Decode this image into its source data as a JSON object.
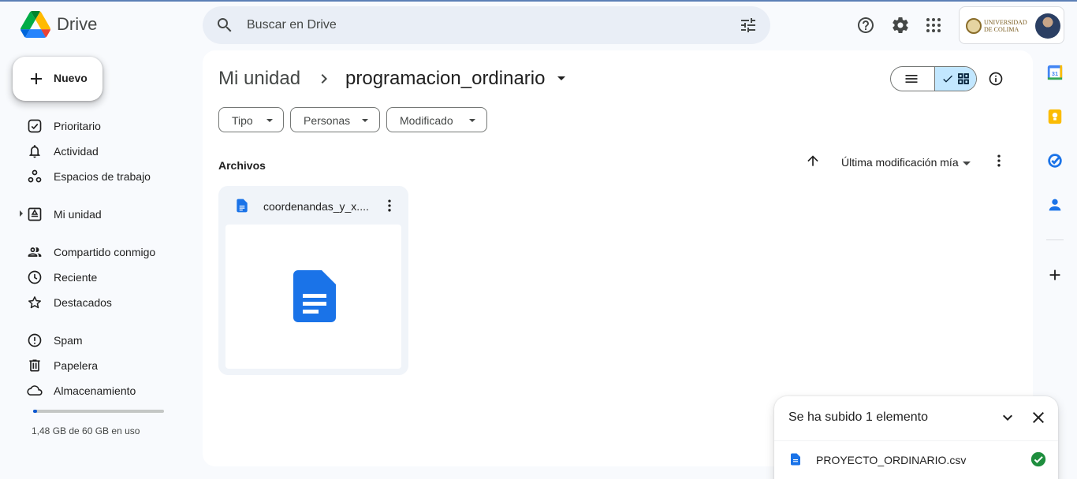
{
  "app": {
    "name": "Drive"
  },
  "search": {
    "placeholder": "Buscar en Drive"
  },
  "account": {
    "org_name_line1": "UNIVERSIDAD",
    "org_name_line2": "DE COLIMA"
  },
  "sidebar": {
    "new_label": "Nuevo",
    "items": [
      {
        "label": "Prioritario",
        "icon": "priority-check-icon"
      },
      {
        "label": "Actividad",
        "icon": "bell-icon"
      },
      {
        "label": "Espacios de trabajo",
        "icon": "workspaces-icon"
      },
      {
        "label": "Mi unidad",
        "icon": "my-drive-icon"
      },
      {
        "label": "Compartido conmigo",
        "icon": "people-icon"
      },
      {
        "label": "Reciente",
        "icon": "clock-icon"
      },
      {
        "label": "Destacados",
        "icon": "star-icon"
      },
      {
        "label": "Spam",
        "icon": "spam-icon"
      },
      {
        "label": "Papelera",
        "icon": "trash-icon"
      },
      {
        "label": "Almacenamiento",
        "icon": "cloud-icon"
      }
    ],
    "storage": {
      "text": "1,48 GB de 60 GB en uso",
      "used_fraction": 0.025
    }
  },
  "main": {
    "breadcrumb_root": "Mi unidad",
    "breadcrumb_current": "programacion_ordinario",
    "filters": [
      "Tipo",
      "Personas",
      "Modificado"
    ],
    "section_title": "Archivos",
    "sort_label": "Última modificación mía",
    "files": [
      {
        "name": "coordenandas_y_x....",
        "type": "google-docs"
      }
    ]
  },
  "upload_toast": {
    "title": "Se ha subido 1 elemento",
    "items": [
      {
        "name": "PROYECTO_ORDINARIO.csv",
        "status": "complete"
      }
    ]
  },
  "colors": {
    "accent": "#0b57d0",
    "doc_blue": "#1a73e8",
    "success_green": "#1e8e3e",
    "selected_toggle": "#c2e7ff"
  }
}
